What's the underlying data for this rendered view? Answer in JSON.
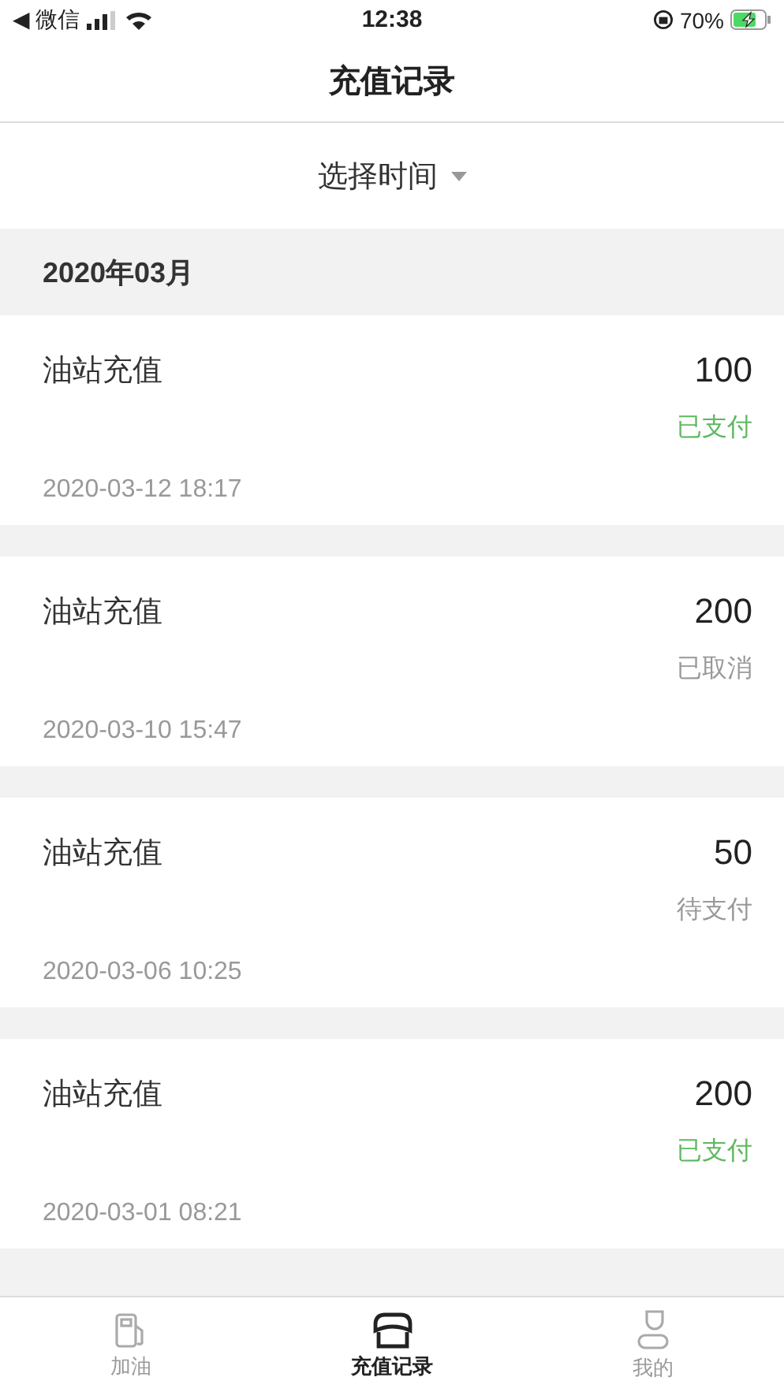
{
  "status_bar": {
    "back_app": "◀ 微信",
    "time": "12:38",
    "battery": "70%"
  },
  "nav": {
    "title": "充值记录"
  },
  "filter": {
    "label": "选择时间"
  },
  "month": "2020年03月",
  "records": [
    {
      "title": "油站充值",
      "amount": "100",
      "status": "已支付",
      "color": "#5fb85f",
      "time": "2020-03-12 18:17"
    },
    {
      "title": "油站充值",
      "amount": "200",
      "status": "已取消",
      "color": "#999999",
      "time": "2020-03-10 15:47"
    },
    {
      "title": "油站充值",
      "amount": "50",
      "status": "待支付",
      "color": "#999999",
      "time": "2020-03-06 10:25"
    },
    {
      "title": "油站充值",
      "amount": "200",
      "status": "已支付",
      "color": "#5fb85f",
      "time": "2020-03-01 08:21"
    }
  ],
  "tabs": [
    {
      "label": "加油",
      "kind": "pump",
      "selected": false
    },
    {
      "label": "充值记录",
      "kind": "store",
      "selected": true
    },
    {
      "label": "我的",
      "kind": "person",
      "selected": false
    }
  ]
}
